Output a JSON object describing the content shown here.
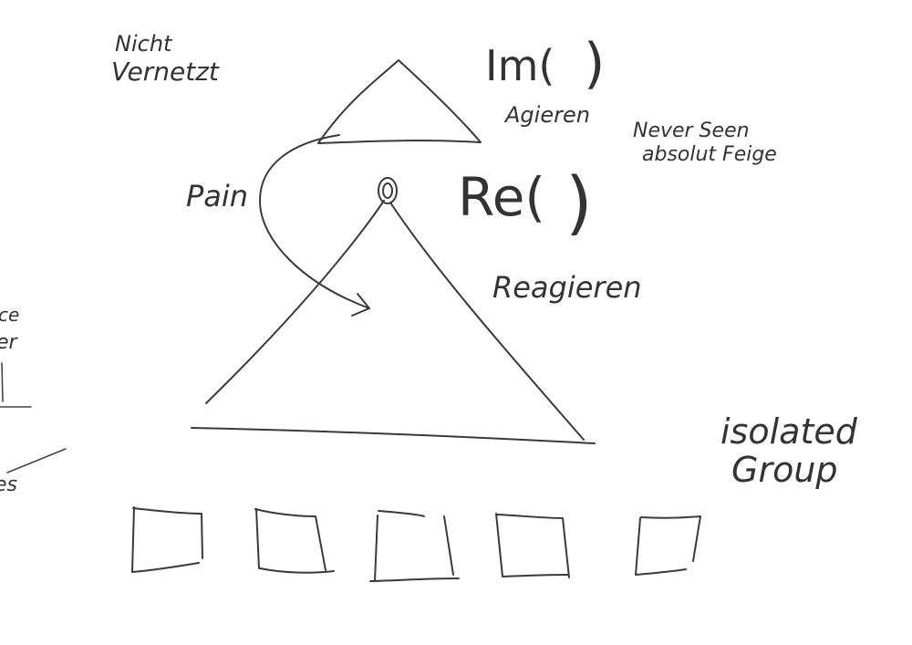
{
  "labels": {
    "nicht_line1": "Nicht",
    "nicht_line2": "Vernetzt",
    "im": "Im(",
    "im_close": ")",
    "agieren": "Agieren",
    "never_seen_line1": "Never Seen",
    "never_seen_line2": "absolut Feige",
    "pain": "Pain",
    "re": "Re(",
    "re_close": ")",
    "reagieren": "Reagieren",
    "isolated_line1": "isolated",
    "isolated_line2": "Group",
    "edge_fragment_1": "ce",
    "edge_fragment_2": "er",
    "edge_fragment_3": "es"
  },
  "colors": {
    "ink": "#3a3a3a",
    "paper": "#ffffff"
  }
}
